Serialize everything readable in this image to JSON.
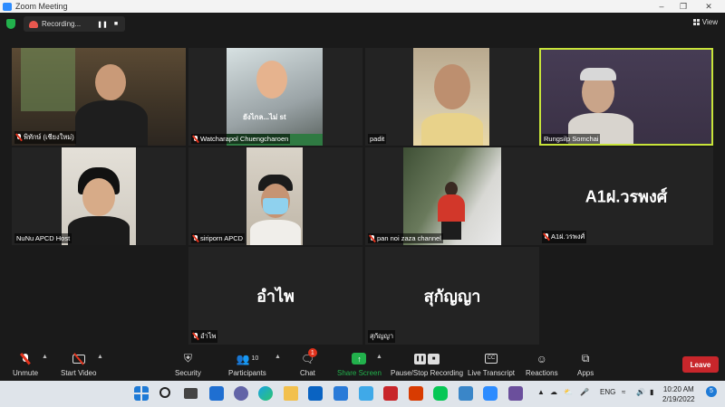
{
  "window": {
    "title": "Zoom Meeting"
  },
  "topbar": {
    "recording_label": "Recording...",
    "view_label": "View"
  },
  "tiles": [
    {
      "name": "พิทักษ์ (เชียงใหม่)",
      "muted": true
    },
    {
      "name": "Watcharapol Chuengcharoen",
      "muted": true,
      "overlay_text": "ยังไกล...ไม่ st"
    },
    {
      "name": "padit",
      "muted": false
    },
    {
      "name": "Rungsilp Somchai",
      "muted": false,
      "active_speaker": true
    },
    {
      "name": "NuNu APCD Host",
      "muted": false
    },
    {
      "name": "siriporn APCD",
      "muted": true
    },
    {
      "name": "pan noi zaza channel",
      "muted": true
    },
    {
      "name": "A1ฝ.วรพงศ์",
      "muted": true,
      "display_text": "A1ฝ.วรพงศ์"
    },
    {
      "name": "อำไพ",
      "muted": true,
      "display_text": "อำไพ"
    },
    {
      "name": "สุกัญญา",
      "muted": false,
      "display_text": "สุกัญญา"
    }
  ],
  "toolbar": {
    "unmute": "Unmute",
    "start_video": "Start Video",
    "security": "Security",
    "participants": "Participants",
    "participants_count": "10",
    "chat": "Chat",
    "chat_badge": "1",
    "share_screen": "Share Screen",
    "pause_stop": "Pause/Stop Recording",
    "live_transcript": "Live Transcript",
    "cc": "CC",
    "reactions": "Reactions",
    "apps": "Apps",
    "leave": "Leave"
  },
  "taskbar": {
    "language": "ENG",
    "time": "10:20 AM",
    "date": "2/19/2022"
  },
  "colors": {
    "share_green": "#22b14c",
    "leave_red": "#c8262b",
    "active_outline": "#c8e43a"
  }
}
